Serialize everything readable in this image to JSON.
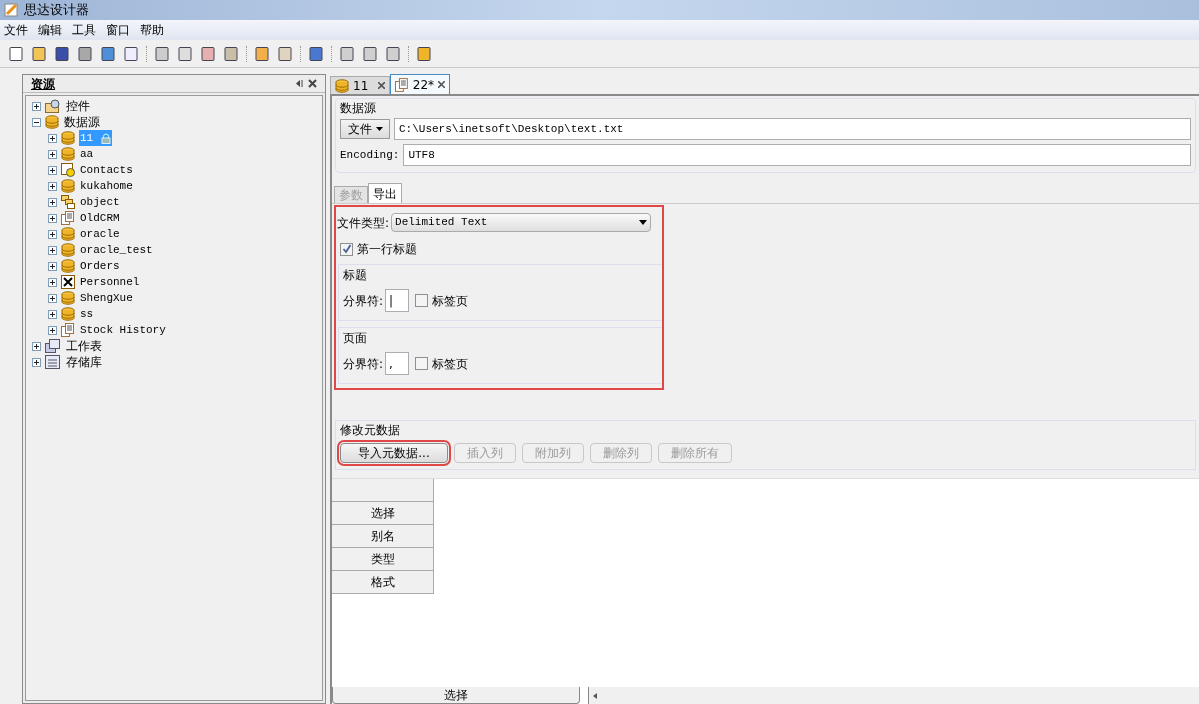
{
  "window": {
    "title": "思达设计器"
  },
  "menu": [
    "文件",
    "编辑",
    "工具",
    "窗口",
    "帮助"
  ],
  "resource_panel": {
    "title": "资源",
    "tree": [
      {
        "label": "控件",
        "kind": "controls",
        "expanded": false,
        "selected": false
      },
      {
        "label": "数据源",
        "kind": "datasource",
        "expanded": true,
        "selected": false,
        "children": [
          {
            "label": "11",
            "kind": "db",
            "expanded": false,
            "selected": true,
            "locked": true
          },
          {
            "label": "aa",
            "kind": "db",
            "expanded": false,
            "selected": false,
            "locked": false
          },
          {
            "label": "Contacts",
            "kind": "contacts",
            "expanded": false,
            "selected": false,
            "locked": false
          },
          {
            "label": "kukahome",
            "kind": "db",
            "expanded": false,
            "selected": false,
            "locked": false
          },
          {
            "label": "object",
            "kind": "object",
            "expanded": false,
            "selected": false,
            "locked": false
          },
          {
            "label": "OldCRM",
            "kind": "doc",
            "expanded": false,
            "selected": false,
            "locked": false
          },
          {
            "label": "oracle",
            "kind": "db",
            "expanded": false,
            "selected": false,
            "locked": false
          },
          {
            "label": "oracle_test",
            "kind": "db",
            "expanded": false,
            "selected": false,
            "locked": false
          },
          {
            "label": "Orders",
            "kind": "db",
            "expanded": false,
            "selected": false,
            "locked": false
          },
          {
            "label": "Personnel",
            "kind": "excel",
            "expanded": false,
            "selected": false,
            "locked": false
          },
          {
            "label": "ShengXue",
            "kind": "db",
            "expanded": false,
            "selected": false,
            "locked": false
          },
          {
            "label": "ss",
            "kind": "db",
            "expanded": false,
            "selected": false,
            "locked": false
          },
          {
            "label": "Stock History",
            "kind": "doc",
            "expanded": false,
            "selected": false,
            "locked": false
          }
        ]
      },
      {
        "label": "工作表",
        "kind": "worksheet",
        "expanded": false,
        "selected": false
      },
      {
        "label": "存储库",
        "kind": "repository",
        "expanded": false,
        "selected": false
      }
    ]
  },
  "editor_tabs": [
    {
      "label": "11",
      "kind": "db",
      "selected": false
    },
    {
      "label": "22*",
      "kind": "doc",
      "selected": true
    }
  ],
  "datasource": {
    "title": "数据源",
    "source_type": "文件",
    "path": "C:\\Users\\inetsoft\\Desktop\\text.txt",
    "encoding_label": "Encoding:",
    "encoding": "UTF8"
  },
  "sub_tabs": [
    {
      "label": "参数",
      "selected": false,
      "disabled": true
    },
    {
      "label": "导出",
      "selected": true,
      "disabled": false
    }
  ],
  "export_options": {
    "highlighted": true,
    "file_type_label": "文件类型:",
    "file_type": "Delimited Text",
    "first_row_header": {
      "label": "第一行标题",
      "checked": true
    },
    "groups": [
      {
        "title": "标题",
        "delimiter_label": "分界符:",
        "delimiter": "|",
        "tab": {
          "label": "标签页",
          "checked": false
        }
      },
      {
        "title": "页面",
        "delimiter_label": "分界符:",
        "delimiter": ",",
        "tab": {
          "label": "标签页",
          "checked": false
        }
      }
    ]
  },
  "metadata": {
    "title": "修改元数据",
    "buttons": [
      {
        "label": "导入元数据...",
        "disabled": false,
        "highlighted": true
      },
      {
        "label": "插入列",
        "disabled": true,
        "highlighted": false
      },
      {
        "label": "附加列",
        "disabled": true,
        "highlighted": false
      },
      {
        "label": "删除列",
        "disabled": true,
        "highlighted": false
      },
      {
        "label": "删除所有",
        "disabled": true,
        "highlighted": false
      }
    ],
    "row_headers": [
      "选择",
      "别名",
      "类型",
      "格式"
    ]
  },
  "bottom_tab": "选择"
}
